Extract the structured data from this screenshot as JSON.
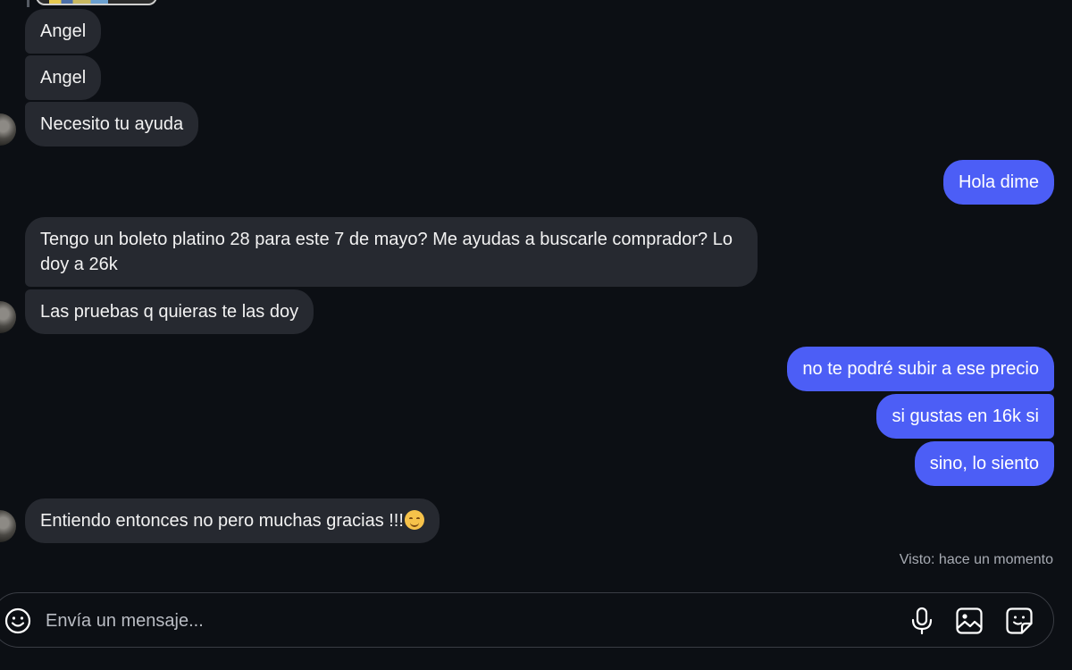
{
  "conversation": {
    "incoming": [
      {
        "text": "Angel"
      },
      {
        "text": "Angel"
      },
      {
        "text": "Necesito tu ayuda"
      },
      {
        "text": "Tengo un boleto platino 28 para este 7 de mayo? Me ayudas a buscarle comprador? Lo doy a 26k"
      },
      {
        "text": "Las pruebas q quieras te las doy"
      },
      {
        "text": "Entiendo entonces no pero muchas gracias !!!",
        "emoji": "smiling-face-emoji"
      }
    ],
    "outgoing": [
      {
        "text": "Hola dime"
      },
      {
        "text": "no te podré subir a ese precio"
      },
      {
        "text": "si gustas en 16k si"
      },
      {
        "text": "sino, lo siento"
      }
    ],
    "seen_status": "Visto: hace un momento"
  },
  "composer": {
    "placeholder": "Envía un mensaje...",
    "value": "",
    "icons": [
      "emoji-icon",
      "microphone-icon",
      "image-icon",
      "sticker-icon"
    ]
  },
  "colors": {
    "background": "#0c0f14",
    "incoming_bubble": "#262930",
    "outgoing_bubble": "#4c5ef6",
    "secondary_text": "#a7abb3"
  }
}
